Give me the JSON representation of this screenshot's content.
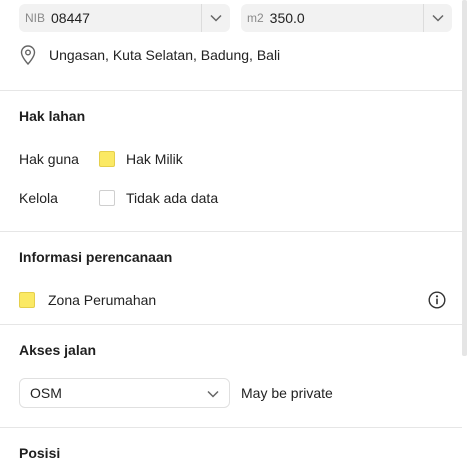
{
  "header": {
    "nib": {
      "prefix": "NIB",
      "value": "08447"
    },
    "area": {
      "prefix": "m2",
      "value": "350.0"
    }
  },
  "location": {
    "icon": "map-pin-icon",
    "text": "Ungasan, Kuta Selatan, Badung, Bali"
  },
  "land_rights": {
    "title": "Hak lahan",
    "rows": [
      {
        "label": "Hak guna",
        "swatch": "yellow",
        "value": "Hak Milik"
      },
      {
        "label": "Kelola",
        "swatch": "empty",
        "value": "Tidak ada data"
      }
    ]
  },
  "planning": {
    "title": "Informasi perencanaan",
    "zone": {
      "swatch": "yellow",
      "label": "Zona Perumahan"
    },
    "info_icon": "info-icon"
  },
  "road_access": {
    "title": "Akses jalan",
    "select_value": "OSM",
    "note": "May be private"
  },
  "position": {
    "title": "Posisi"
  },
  "colors": {
    "swatch_yellow": "#fbe964",
    "field_bg": "#f2f2f2",
    "divider": "#e6e6e6"
  }
}
